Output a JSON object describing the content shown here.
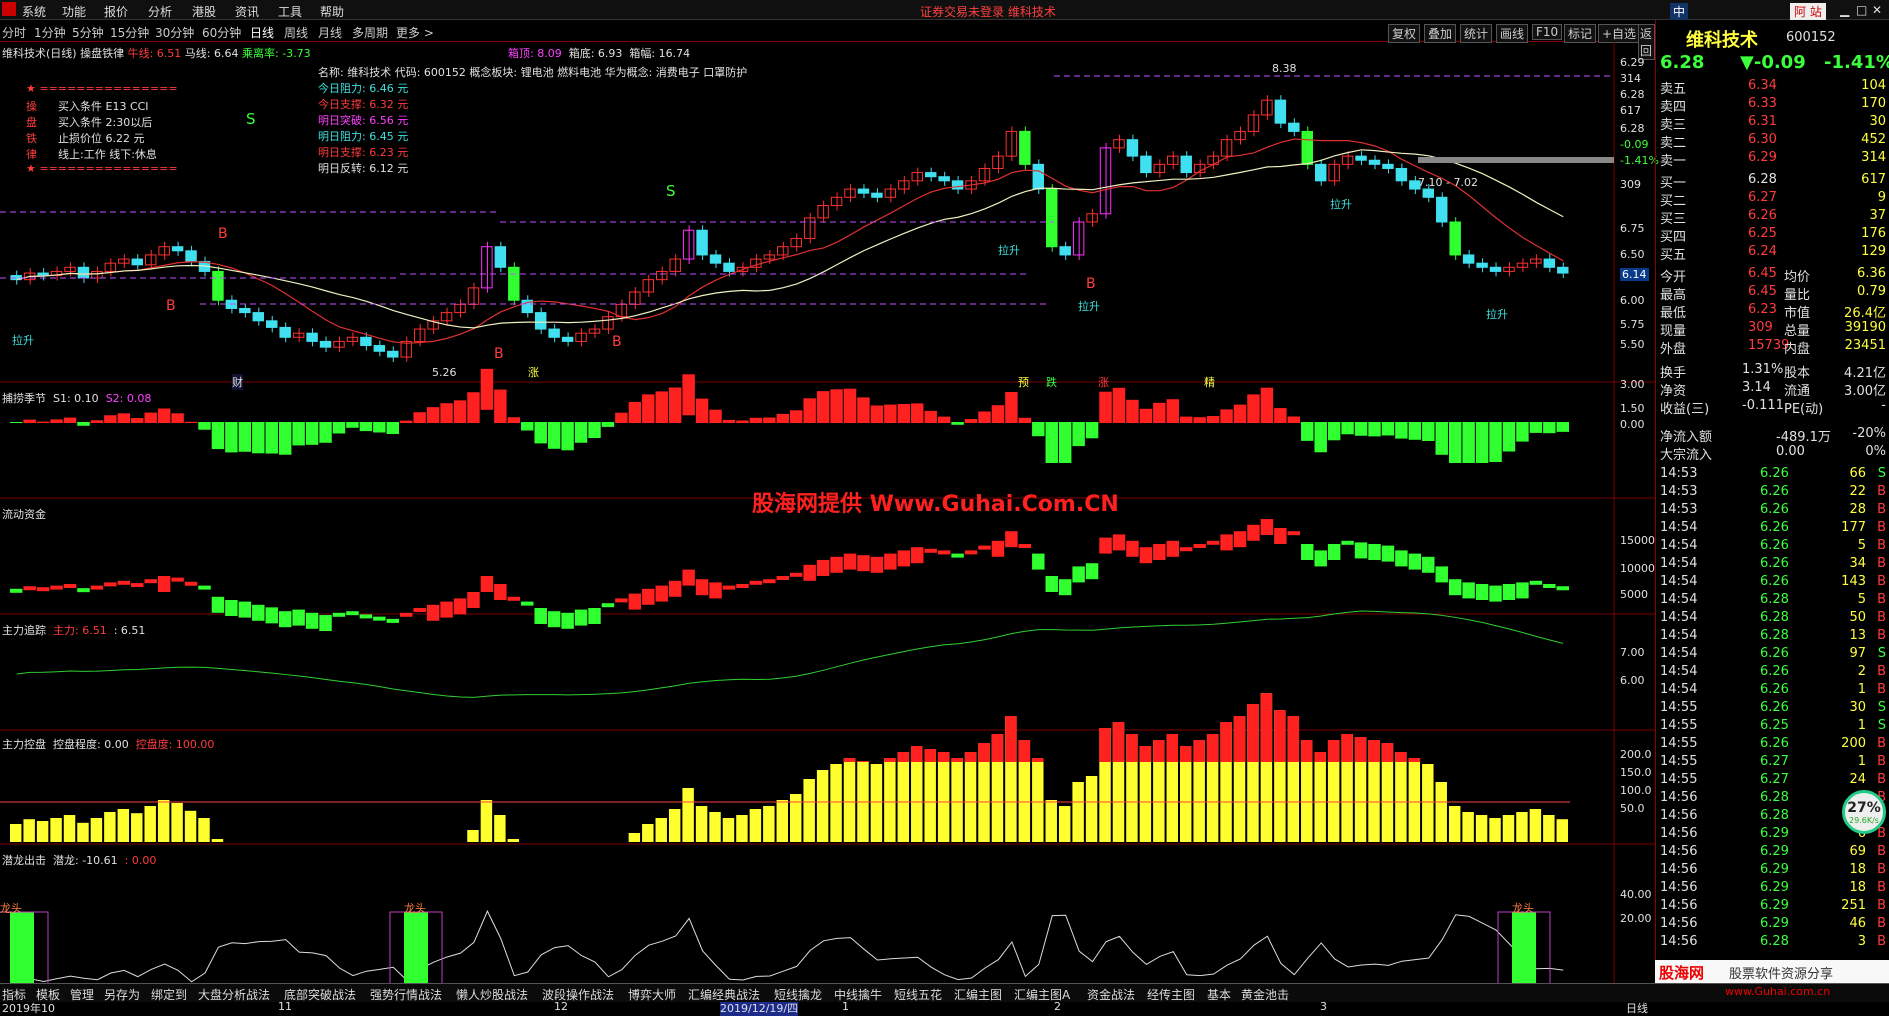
{
  "menu": [
    "系统",
    "功能",
    "报价",
    "分析",
    "港股",
    "资讯",
    "工具",
    "帮助"
  ],
  "title": "证券交易未登录  维科技术",
  "top_right": {
    "lang": "中",
    "badge": "阿 站"
  },
  "periods": [
    "分时",
    "1分钟",
    "5分钟",
    "15分钟",
    "30分钟",
    "60分钟",
    "日线",
    "周线",
    "月线",
    "多周期",
    "更多 >"
  ],
  "right_tabs": [
    "复权",
    "叠加",
    "统计",
    "画线",
    "F10",
    "标记",
    "+自选",
    "返回"
  ],
  "main_legend": {
    "name": "维科技术(日线)",
    "ind": "操盘铁律",
    "l1": "牛线: 6.51",
    "l2": "马线: 6.64",
    "l3": "乘离率: -3.73",
    "box_top": "箱顶: 8.09",
    "box_bot": "箱底: 6.93",
    "box_w": "箱幅: 16.74"
  },
  "info": {
    "line1": "名称: 维科技术 代码: 600152 概念板块: 锂电池 燃料电池 华为概念: 消费电子 口罩防护",
    "today_res": "今日阻力:  6.46 元",
    "today_sup": "今日支撑:  6.32 元",
    "tmr_break": "明日突破:  6.56 元",
    "tmr_res": "明日阻力:  6.45 元",
    "tmr_sup": "明日支撑:  6.23 元",
    "tmr_rev": "明日反转:  6.12 元"
  },
  "rules": {
    "stars": "★ ===============",
    "r1k": "操",
    "r1": "买入条件 E13 CCI",
    "r2k": "盘",
    "r2": "买入条件 2:30以后",
    "r3k": "铁",
    "r3": "止损价位 6.22 元",
    "r4k": "律",
    "r4": "线上:工作 线下:休息",
    "end": "★ ==============="
  },
  "marks": {
    "s": "S",
    "b": "B",
    "lasheng": "拉升",
    "high": "8.38",
    "low": "5.26",
    "cai": "财",
    "zhang": "涨",
    "yu": "预",
    "die": "跌",
    "zhang2": "涨",
    "jing": "精",
    "band": "7.10 - 7.02"
  },
  "main_axis": [
    "6.29",
    "314",
    "6.28",
    "617",
    "6.28",
    "-0.09",
    "-1.41%",
    "309",
    "6.75",
    "6.50",
    "6.14",
    "6.00",
    "5.75",
    "5.50"
  ],
  "p2": {
    "name": "捕捞季节",
    "s1": "S1: 0.10",
    "s2": "S2: 0.08",
    "axis": [
      "3.00",
      "1.50",
      "0.00"
    ]
  },
  "watermark": "股海网提供 Www.Guhai.Com.CN",
  "p3": {
    "name": "流动资金",
    "axis": [
      "15000",
      "10000",
      "5000"
    ]
  },
  "p4": {
    "name": "主力追踪",
    "a": "主力: 6.51",
    "b": ": 6.51",
    "axis": [
      "7.00",
      "6.00"
    ]
  },
  "p5": {
    "name": "主力控盘",
    "a": "控盘程度: 0.00",
    "b": "控盘度: 100.00",
    "axis": [
      "200.0",
      "150.0",
      "100.0",
      "50.0"
    ]
  },
  "p6": {
    "name": "潜龙出击",
    "a": "潜龙: -10.61",
    "b": ": 0.00",
    "axis": [
      "40.00",
      "20.00"
    ],
    "longtou": "龙头"
  },
  "dates": [
    "2019年10",
    "11",
    "12",
    "2019/12/19/四",
    "1",
    "2",
    "3"
  ],
  "date_tag": "日线",
  "side": {
    "name": "维科技术",
    "code": "600152",
    "price": "6.28",
    "chg": "▼-0.09",
    "pct": "-1.41%",
    "asks": [
      [
        "卖五",
        "6.34",
        "104"
      ],
      [
        "卖四",
        "6.33",
        "170"
      ],
      [
        "卖三",
        "6.31",
        "30"
      ],
      [
        "卖二",
        "6.30",
        "452"
      ],
      [
        "卖一",
        "6.29",
        "314"
      ]
    ],
    "bids": [
      [
        "买一",
        "6.28",
        "617"
      ],
      [
        "买二",
        "6.27",
        "9"
      ],
      [
        "买三",
        "6.26",
        "37"
      ],
      [
        "买四",
        "6.25",
        "176"
      ],
      [
        "买五",
        "6.24",
        "129"
      ]
    ],
    "stats": [
      [
        "今开",
        "6.45",
        "均价",
        "6.36"
      ],
      [
        "最高",
        "6.45",
        "量比",
        "0.79"
      ],
      [
        "最低",
        "6.23",
        "市值",
        "26.4亿"
      ],
      [
        "现量",
        "309",
        "总量",
        "39190"
      ],
      [
        "外盘",
        "15739",
        "内盘",
        "23451"
      ]
    ],
    "stats2": [
      [
        "换手",
        "1.31%",
        "股本",
        "4.21亿"
      ],
      [
        "净资",
        "3.14",
        "流通",
        "3.00亿"
      ],
      [
        "收益(三)",
        "-0.111",
        "PE(动)",
        "-"
      ]
    ],
    "flow": [
      [
        "净流入额",
        "-489.1万",
        "-20%"
      ],
      [
        "大宗流入",
        "0.00",
        "0%"
      ]
    ],
    "ticks": [
      [
        "14:53",
        "6.26",
        "66",
        "S"
      ],
      [
        "14:53",
        "6.26",
        "22",
        "B"
      ],
      [
        "14:53",
        "6.26",
        "28",
        "B"
      ],
      [
        "14:54",
        "6.26",
        "177",
        "B"
      ],
      [
        "14:54",
        "6.26",
        "5",
        "B"
      ],
      [
        "14:54",
        "6.26",
        "34",
        "B"
      ],
      [
        "14:54",
        "6.26",
        "143",
        "B"
      ],
      [
        "14:54",
        "6.28",
        "5",
        "B"
      ],
      [
        "14:54",
        "6.28",
        "50",
        "B"
      ],
      [
        "14:54",
        "6.28",
        "13",
        "B"
      ],
      [
        "14:54",
        "6.26",
        "97",
        "S"
      ],
      [
        "14:54",
        "6.26",
        "2",
        "B"
      ],
      [
        "14:54",
        "6.26",
        "1",
        "B"
      ],
      [
        "14:55",
        "6.26",
        "30",
        "S"
      ],
      [
        "14:55",
        "6.25",
        "1",
        "S"
      ],
      [
        "14:55",
        "6.26",
        "200",
        "B"
      ],
      [
        "14:55",
        "6.27",
        "1",
        "B"
      ],
      [
        "14:55",
        "6.27",
        "24",
        "B"
      ],
      [
        "14:56",
        "6.28",
        "4",
        "B"
      ],
      [
        "14:56",
        "6.28",
        "7",
        "B"
      ],
      [
        "14:56",
        "6.29",
        "6",
        "B"
      ],
      [
        "14:56",
        "6.29",
        "69",
        "B"
      ],
      [
        "14:56",
        "6.29",
        "18",
        "B"
      ],
      [
        "14:56",
        "6.29",
        "18",
        "B"
      ],
      [
        "14:56",
        "6.29",
        "251",
        "B"
      ],
      [
        "14:56",
        "6.29",
        "46",
        "B"
      ],
      [
        "14:56",
        "6.28",
        "3",
        "B"
      ]
    ],
    "gauge": "27%",
    "speed": "29.6K/s"
  },
  "bottom_tabs": [
    "指标",
    "模板",
    "管理",
    "另存为",
    "绑定到",
    "大盘分析战法",
    "底部突破战法",
    "强势行情战法",
    "懒人炒股战法",
    "波段操作战法",
    "博弈大师",
    "汇编经典战法",
    "短线擒龙",
    "中线擒牛",
    "短线五花",
    "汇编主图",
    "汇编主图A",
    "资金战法",
    "经传主图",
    "基本",
    "黄金池击"
  ],
  "brand": "股海网",
  "slogan": "股票软件资源分享",
  "url": "www.Guhai.com.cn",
  "chart_data": {
    "type": "candlestick",
    "series_note": "daily candles, approx",
    "closes": [
      6.2,
      6.28,
      6.25,
      6.3,
      6.35,
      6.22,
      6.3,
      6.4,
      6.45,
      6.38,
      6.5,
      6.6,
      6.55,
      6.42,
      6.3,
      5.95,
      5.85,
      5.8,
      5.7,
      5.62,
      5.5,
      5.55,
      5.45,
      5.38,
      5.45,
      5.5,
      5.4,
      5.33,
      5.26,
      5.45,
      5.6,
      5.7,
      5.8,
      5.9,
      6.1,
      6.6,
      6.35,
      5.95,
      5.8,
      5.6,
      5.5,
      5.45,
      5.55,
      5.6,
      5.75,
      5.9,
      6.05,
      6.2,
      6.3,
      6.45,
      6.8,
      6.5,
      6.4,
      6.3,
      6.35,
      6.45,
      6.5,
      6.6,
      6.7,
      6.95,
      7.1,
      7.2,
      7.3,
      7.25,
      7.2,
      7.3,
      7.4,
      7.5,
      7.45,
      7.4,
      7.3,
      7.4,
      7.55,
      7.7,
      8.0,
      7.6,
      7.3,
      6.6,
      6.5,
      6.9,
      7.0,
      7.8,
      7.9,
      7.7,
      7.5,
      7.6,
      7.7,
      7.5,
      7.6,
      7.7,
      7.9,
      8.0,
      8.2,
      8.38,
      8.1,
      8.0,
      7.6,
      7.4,
      7.6,
      7.7,
      7.65,
      7.6,
      7.55,
      7.4,
      7.3,
      7.2,
      6.9,
      6.5,
      6.4,
      6.35,
      6.3,
      6.35,
      6.4,
      6.45,
      6.35,
      6.28
    ]
  }
}
